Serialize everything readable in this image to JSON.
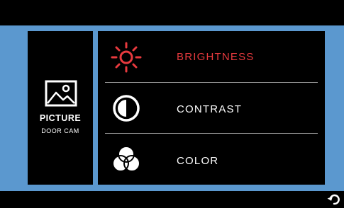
{
  "panel": {
    "title": "PICTURE",
    "subtitle": "DOOR CAM",
    "icon": "picture-icon"
  },
  "menu": {
    "items": [
      {
        "label": "BRIGHTNESS",
        "icon": "brightness-icon",
        "selected": true
      },
      {
        "label": "CONTRAST",
        "icon": "contrast-icon",
        "selected": false
      },
      {
        "label": "COLOR",
        "icon": "color-icon",
        "selected": false
      }
    ]
  },
  "colors": {
    "accent": "#e83a3e",
    "frame": "#5b98cf",
    "background": "#000000",
    "text": "#ffffff"
  },
  "footer": {
    "icon": "back-icon"
  }
}
